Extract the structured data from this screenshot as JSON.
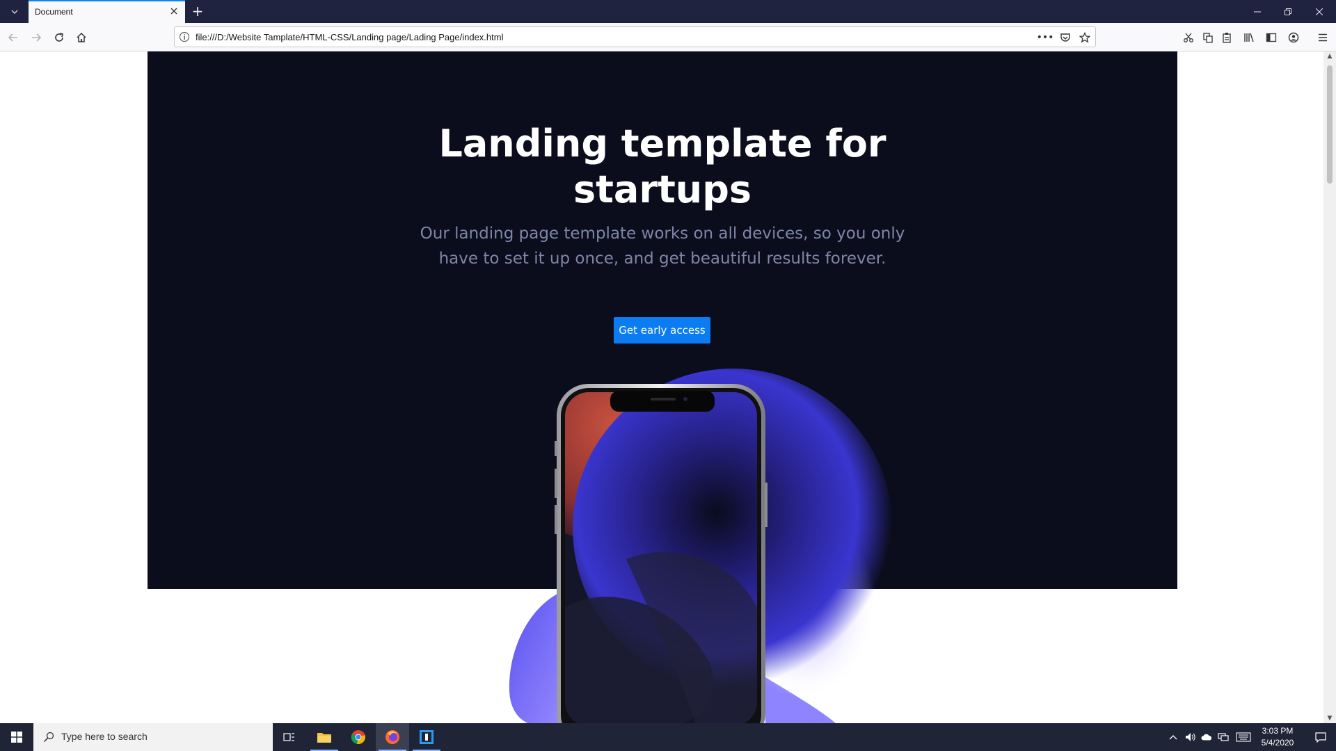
{
  "browser": {
    "tab_title": "Document",
    "new_tab_label": "+",
    "url": "file:///D:/Website Tamplate/HTML-CSS/Landing page/Lading Page/index.html",
    "page_actions_label": "•••"
  },
  "hero": {
    "title_line1": "Landing template for",
    "title_line2": "startups",
    "subtitle": "Our landing page template works on all devices, so you only have to set it up once, and get beautiful results forever.",
    "cta_label": "Get early access"
  },
  "taskbar": {
    "search_placeholder": "Type here to search",
    "time": "3:03 PM",
    "date": "5/4/2020"
  },
  "colors": {
    "hero_bg": "#0b0d1c",
    "cta_bg": "#0c7cf2",
    "accent_purple": "#6a5cff",
    "accent_red": "#c2503f"
  }
}
